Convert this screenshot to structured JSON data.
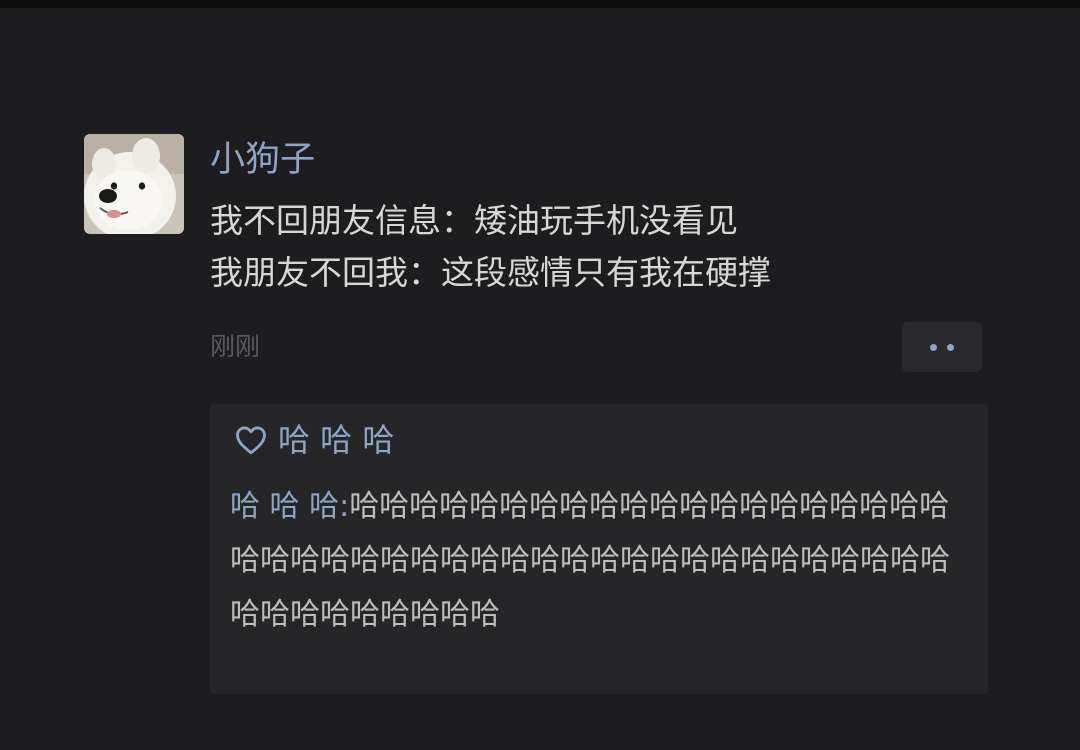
{
  "post": {
    "author": "小狗子",
    "lines": [
      "我不回朋友信息：矮油玩手机没看见",
      "我朋友不回我：这段感情只有我在硬撑"
    ],
    "time": "刚刚"
  },
  "likes": {
    "icon": "heart-icon",
    "names": "哈 哈 哈"
  },
  "comment": {
    "author": "哈 哈 哈",
    "separator": ":",
    "text": "哈哈哈哈哈哈哈哈哈哈哈哈哈哈哈哈哈哈哈哈哈哈哈哈哈哈哈哈哈哈哈哈哈哈哈哈哈哈哈哈哈哈哈哈哈哈哈哈哈哈哈哈哈"
  },
  "colors": {
    "background": "#1d1d1f",
    "link_blue": "#8fa3c4",
    "text": "#d7d7d7",
    "muted": "#5b5b5e",
    "panel": "#262628"
  }
}
